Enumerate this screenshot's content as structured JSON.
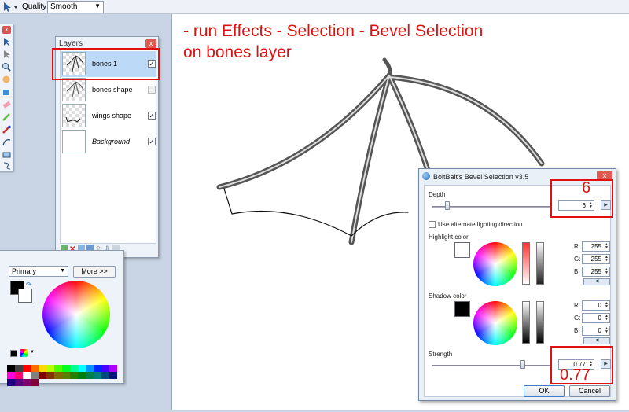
{
  "toolbar": {
    "quality_label": "Quality:",
    "quality_value": "Smooth"
  },
  "annotation": {
    "line1": "- run Effects - Selection - Bevel Selection",
    "line2": "on bones layer",
    "depth_note": "6",
    "strength_note": "0.77",
    "color": "#e01010"
  },
  "layers": {
    "title": "Layers",
    "items": [
      {
        "name": "bones 1",
        "visible": true,
        "selected": true
      },
      {
        "name": "bones shape",
        "visible": false,
        "selected": false
      },
      {
        "name": "wings shape",
        "visible": true,
        "selected": false
      },
      {
        "name": "Background",
        "visible": true,
        "selected": false
      }
    ]
  },
  "colors": {
    "mode": "Primary",
    "more_label": "More >>",
    "palette": [
      "#000000",
      "#404040",
      "#ff0000",
      "#ff6a00",
      "#ffd800",
      "#b6ff00",
      "#4cff00",
      "#00ff21",
      "#00ff90",
      "#00ffff",
      "#0094ff",
      "#0026ff",
      "#4800ff",
      "#b200ff",
      "#ff00dc",
      "#ff006e",
      "#ffffff",
      "#808080",
      "#7f0000",
      "#7f3300",
      "#7f6a00",
      "#5b7f00",
      "#267f00",
      "#007f0e",
      "#007f46",
      "#007f7f",
      "#004a7f",
      "#00137f",
      "#21007f",
      "#57007f",
      "#7f006e",
      "#7f0037"
    ]
  },
  "dialog": {
    "title": "BoltBait's Bevel Selection v3.5",
    "depth_label": "Depth",
    "depth_value": "6",
    "alt_lighting_label": "Use alternate lighting direction",
    "highlight_label": "Highlight color",
    "highlight": {
      "r_label": "R:",
      "g_label": "G:",
      "b_label": "B:",
      "r": "255",
      "g": "255",
      "b": "255",
      "swatch": "#ffffff"
    },
    "shadow_label": "Shadow color",
    "shadow": {
      "r_label": "R:",
      "g_label": "G:",
      "b_label": "B:",
      "r": "0",
      "g": "0",
      "b": "0",
      "swatch": "#000000"
    },
    "strength_label": "Strength",
    "strength_value": "0.77",
    "ok_label": "OK",
    "cancel_label": "Cancel"
  }
}
